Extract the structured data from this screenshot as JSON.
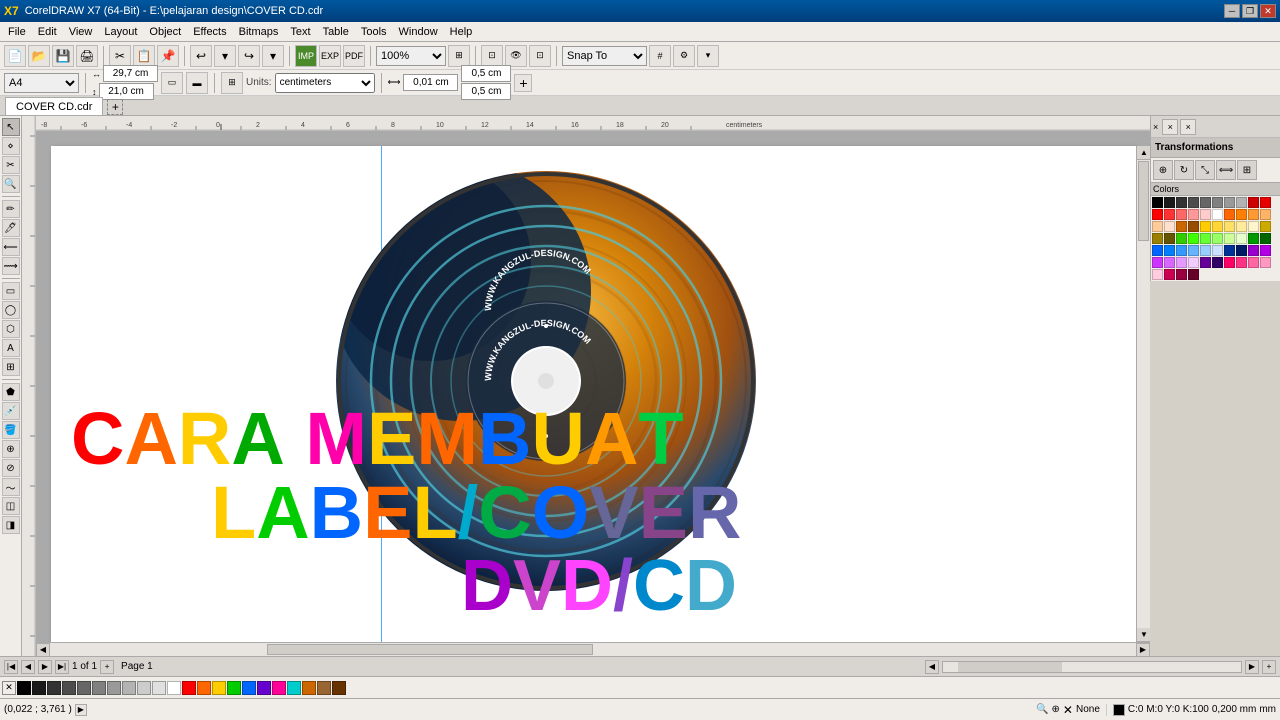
{
  "titlebar": {
    "title": "CorelDRAW X7 (64-Bit) - E:\\pelajaran design\\COVER CD.cdr",
    "logo": "CDR",
    "min": "─",
    "restore": "❐",
    "close": "✕"
  },
  "menubar": {
    "items": [
      "File",
      "Edit",
      "View",
      "Layout",
      "Object",
      "Effects",
      "Bitmaps",
      "Text",
      "Table",
      "Tools",
      "Window",
      "Help"
    ]
  },
  "toolbar": {
    "zoom_value": "100%",
    "snap_label": "Snap To",
    "width_value": "29,7 cm",
    "height_value": "21,0 cm",
    "unit_label": "Units:",
    "unit_value": "centimeters",
    "nudge_label": "0,01 cm",
    "nudge2_label": "0,5 cm",
    "nudge3_label": "0,5 cm"
  },
  "page_selector": {
    "value": "A4"
  },
  "tab": {
    "name": "COVER CD.cdr",
    "page_info": "1 of 1",
    "page_name": "Page 1"
  },
  "canvas": {
    "design_text_line1": "CARA MEMBUAT",
    "design_text_line2": "LABEL/COVER",
    "design_text_line3": "DVD/CD",
    "cd_label": "WWW.KANGZUL-DESIGN.COM"
  },
  "statusbar": {
    "coords": "(0,022 ; 3,761 )",
    "fill_label": "None",
    "color_info": "C:0 M:0 Y:0 K:100",
    "stroke_info": "0,200 mm"
  },
  "colors": {
    "palette": [
      "#000000",
      "#1a1a1a",
      "#333333",
      "#4d4d4d",
      "#666666",
      "#808080",
      "#999999",
      "#b3b3b3",
      "#cc0000",
      "#e60000",
      "#ff0000",
      "#ff3333",
      "#ff6666",
      "#ff9999",
      "#ffcccc",
      "#ffffff",
      "#ff6600",
      "#ff8000",
      "#ff9933",
      "#ffb366",
      "#ffcc99",
      "#ffe0cc",
      "#cc6600",
      "#994c00",
      "#ffcc00",
      "#ffd633",
      "#ffe066",
      "#ffeb99",
      "#fff5cc",
      "#ccaa00",
      "#998000",
      "#665500",
      "#33cc00",
      "#40ff00",
      "#66ff33",
      "#99ff66",
      "#ccff99",
      "#e6ffcc",
      "#009900",
      "#006600",
      "#0066ff",
      "#0080ff",
      "#3399ff",
      "#66b3ff",
      "#99ccff",
      "#cce0ff",
      "#003399",
      "#001a66",
      "#9900cc",
      "#b300e6",
      "#cc33ff",
      "#d966ff",
      "#e699ff",
      "#f2ccff",
      "#660099",
      "#330066",
      "#ff0066",
      "#ff3385",
      "#ff66a3",
      "#ff99c2",
      "#ffcce0",
      "#cc0052",
      "#990040",
      "#66002b"
    ],
    "bottom_swatches": [
      "#000000",
      "#1a1a1a",
      "#333333",
      "#4d4d4d",
      "#666666",
      "#808080",
      "#999999",
      "#b3b3b3",
      "#cccccc",
      "#e0e0e0",
      "#ffffff",
      "#ff0000",
      "#ff6600",
      "#ffcc00",
      "#00cc00",
      "#0066ff",
      "#6600cc",
      "#ff0099",
      "#00cccc",
      "#cc6600",
      "#996633",
      "#663300"
    ]
  },
  "transform_panel": {
    "title": "Transformations"
  }
}
